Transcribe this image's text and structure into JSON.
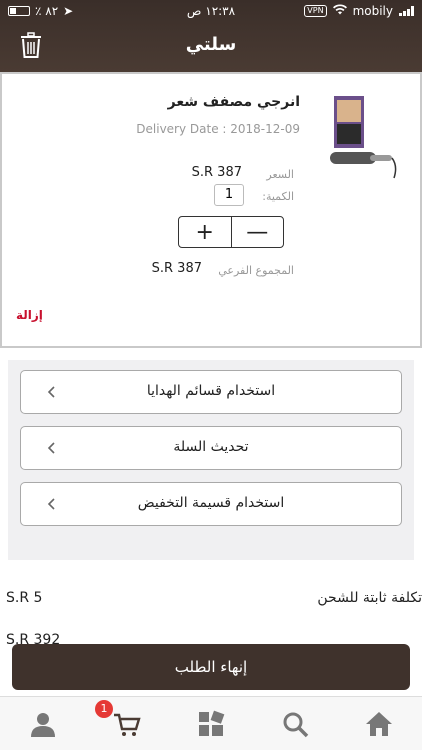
{
  "status_bar": {
    "battery_pct": "٪ ٨٢",
    "time": "١٢:٣٨ ص",
    "vpn_label": "VPN",
    "carrier": "mobily"
  },
  "header": {
    "title": "سلتي",
    "trash_icon": "trash-icon"
  },
  "cart_item": {
    "name": "انرجي مصفف شعر",
    "delivery_date": "Delivery Date : 2018-12-09",
    "price_label": "السعر",
    "price_value": "S.R 387",
    "qty_label": "الكمية:",
    "qty_value": "1",
    "plus": "+",
    "minus": "—",
    "subtotal_label": "المجموع الفرعي",
    "subtotal_value": "S.R 387",
    "remove_label": "إزالة"
  },
  "options": [
    {
      "label": "استخدام قسائم الهدايا"
    },
    {
      "label": "تحديث السلة"
    },
    {
      "label": "استخدام قسيمة التخفيض"
    }
  ],
  "summary": {
    "shipping_label": "تكلفة ثابتة للشحن",
    "shipping_value": "S.R 5",
    "partial_value": "S.R 392"
  },
  "checkout_label": "إنهاء الطلب",
  "tabbar": {
    "cart_badge": "1",
    "icons": [
      "user-icon",
      "cart-icon",
      "categories-icon",
      "search-icon",
      "home-icon"
    ]
  },
  "colors": {
    "header_bg": "#3a2e29",
    "checkout_bg": "#3f322c",
    "remove_red": "#c8102e",
    "badge_red": "#e53935"
  }
}
